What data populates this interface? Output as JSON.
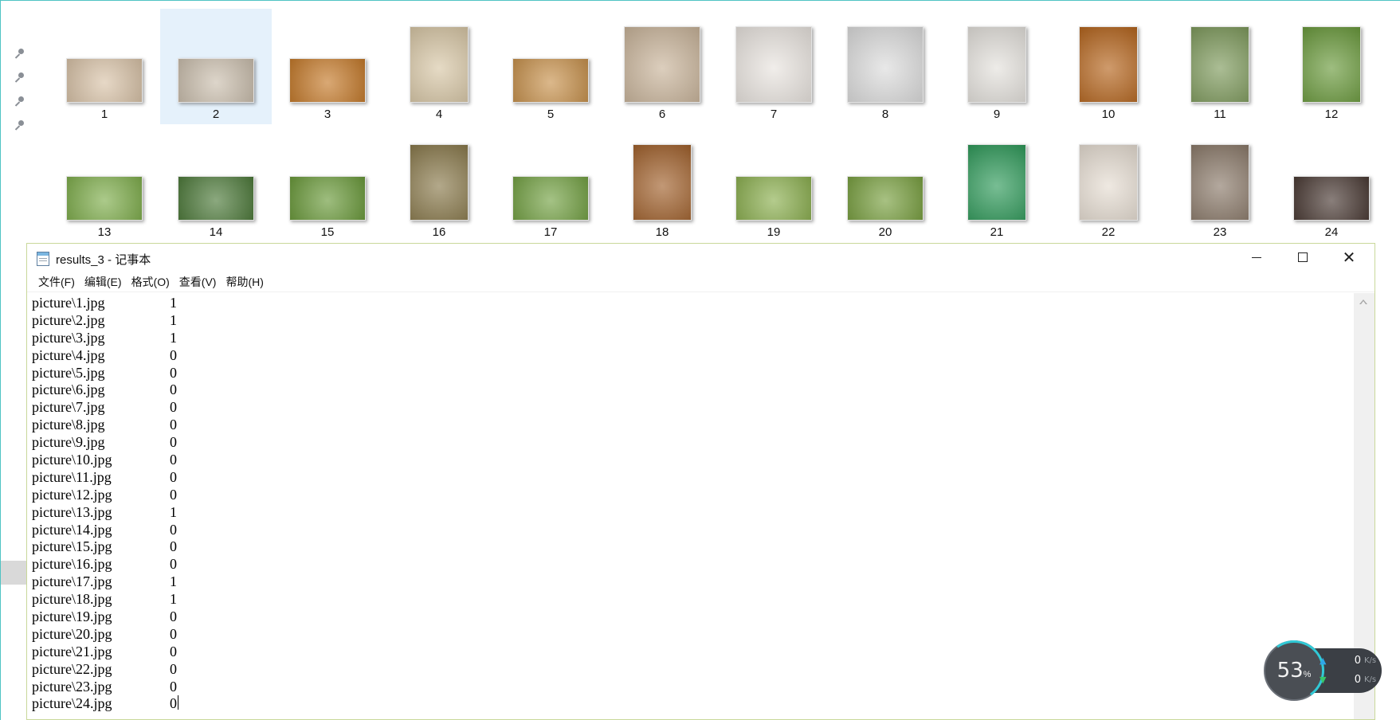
{
  "explorer": {
    "thumbnails_row_1": [
      {
        "label": "1",
        "scene": "kitten",
        "color": "#d9c3a8",
        "aspect": "landscape"
      },
      {
        "label": "2",
        "scene": "tabby-kitten",
        "color": "#cbbfae",
        "aspect": "landscape"
      },
      {
        "label": "3",
        "scene": "orange-cat",
        "color": "#c57a2a",
        "aspect": "landscape"
      },
      {
        "label": "4",
        "scene": "lab-puppy",
        "color": "#d8c7a6",
        "aspect": "portrait"
      },
      {
        "label": "5",
        "scene": "golden-retriever-face",
        "color": "#c8924d",
        "aspect": "landscape"
      },
      {
        "label": "6",
        "scene": "pug",
        "color": "#c9b49a",
        "aspect": "square"
      },
      {
        "label": "7",
        "scene": "chihuahua",
        "color": "#e9e4df",
        "aspect": "square"
      },
      {
        "label": "8",
        "scene": "french-bulldog",
        "color": "#dcdcdc",
        "aspect": "square"
      },
      {
        "label": "9",
        "scene": "white-puppy",
        "color": "#e4e1dc",
        "aspect": "portrait"
      },
      {
        "label": "10",
        "scene": "golden-retriever",
        "color": "#b5651d",
        "aspect": "portrait"
      },
      {
        "label": "11",
        "scene": "dog-on-path",
        "color": "#7e9a5c",
        "aspect": "portrait"
      },
      {
        "label": "12",
        "scene": "black-dog-grass",
        "color": "#6a9a3c",
        "aspect": "portrait"
      }
    ],
    "thumbnails_row_2": [
      {
        "label": "13",
        "scene": "dogs-on-grass",
        "color": "#7fae4c",
        "aspect": "landscape"
      },
      {
        "label": "14",
        "scene": "collie-profile",
        "color": "#4d7a3a",
        "aspect": "landscape"
      },
      {
        "label": "15",
        "scene": "dog-in-field",
        "color": "#6a9a3a",
        "aspect": "landscape"
      },
      {
        "label": "16",
        "scene": "terrier-grass",
        "color": "#8a7a4c",
        "aspect": "portrait"
      },
      {
        "label": "17",
        "scene": "puppy-lying-grass",
        "color": "#74a244",
        "aspect": "landscape"
      },
      {
        "label": "18",
        "scene": "shiba",
        "color": "#a1612c",
        "aspect": "portrait"
      },
      {
        "label": "19",
        "scene": "fluffy-dog-grass",
        "color": "#8cb050",
        "aspect": "landscape"
      },
      {
        "label": "20",
        "scene": "dog-lying-field",
        "color": "#79a040",
        "aspect": "landscape"
      },
      {
        "label": "21",
        "scene": "chow-green-bg",
        "color": "#2f9a5a",
        "aspect": "portrait"
      },
      {
        "label": "22",
        "scene": "boxer-puppy",
        "color": "#e6ddd2",
        "aspect": "portrait"
      },
      {
        "label": "23",
        "scene": "dogs-indoor",
        "color": "#8b7a6a",
        "aspect": "portrait"
      },
      {
        "label": "24",
        "scene": "white-dog-lying",
        "color": "#4a3a34",
        "aspect": "landscape"
      }
    ],
    "selected_index": 1
  },
  "notepad": {
    "title": "results_3 - 记事本",
    "menu": [
      "文件(F)",
      "编辑(E)",
      "格式(O)",
      "查看(V)",
      "帮助(H)"
    ],
    "lines": [
      {
        "path": "picture\\1.jpg",
        "value": "1"
      },
      {
        "path": "picture\\2.jpg",
        "value": "1"
      },
      {
        "path": "picture\\3.jpg",
        "value": "1"
      },
      {
        "path": "picture\\4.jpg",
        "value": "0"
      },
      {
        "path": "picture\\5.jpg",
        "value": "0"
      },
      {
        "path": "picture\\6.jpg",
        "value": "0"
      },
      {
        "path": "picture\\7.jpg",
        "value": "0"
      },
      {
        "path": "picture\\8.jpg",
        "value": "0"
      },
      {
        "path": "picture\\9.jpg",
        "value": "0"
      },
      {
        "path": "picture\\10.jpg",
        "value": "0"
      },
      {
        "path": "picture\\11.jpg",
        "value": "0"
      },
      {
        "path": "picture\\12.jpg",
        "value": "0"
      },
      {
        "path": "picture\\13.jpg",
        "value": "1"
      },
      {
        "path": "picture\\14.jpg",
        "value": "0"
      },
      {
        "path": "picture\\15.jpg",
        "value": "0"
      },
      {
        "path": "picture\\16.jpg",
        "value": "0"
      },
      {
        "path": "picture\\17.jpg",
        "value": "1"
      },
      {
        "path": "picture\\18.jpg",
        "value": "1"
      },
      {
        "path": "picture\\19.jpg",
        "value": "0"
      },
      {
        "path": "picture\\20.jpg",
        "value": "0"
      },
      {
        "path": "picture\\21.jpg",
        "value": "0"
      },
      {
        "path": "picture\\22.jpg",
        "value": "0"
      },
      {
        "path": "picture\\23.jpg",
        "value": "0"
      },
      {
        "path": "picture\\24.jpg",
        "value": "0"
      }
    ]
  },
  "speed_widget": {
    "percent": "53",
    "percent_unit": "%",
    "upload": "0",
    "download": "0",
    "unit": "K/s"
  }
}
